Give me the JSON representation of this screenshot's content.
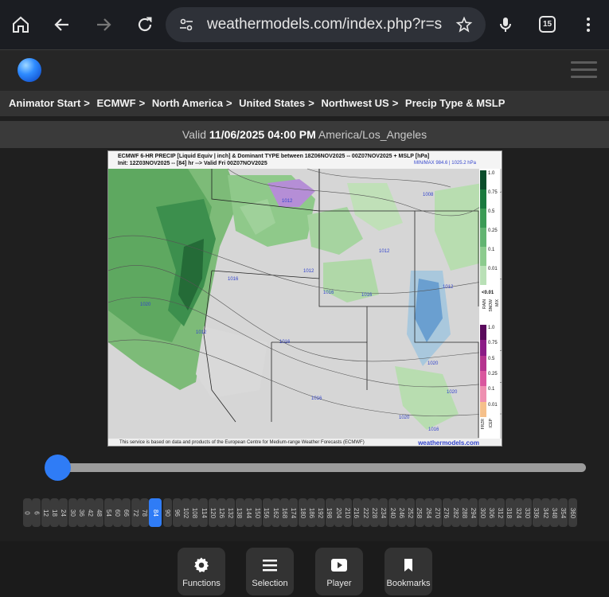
{
  "browser": {
    "url": "weathermodels.com/index.php?r=site",
    "tab_count": "15"
  },
  "breadcrumb": [
    "Animator Start",
    "ECMWF",
    "North America",
    "United States",
    "Northwest US",
    "Precip Type & MSLP"
  ],
  "valid": {
    "prefix": "Valid",
    "datetime": "11/06/2025 04:00 PM",
    "timezone": "America/Los_Angeles"
  },
  "map": {
    "title_line1": "ECMWF 6-HR PRECIP [Liquid Equiv | inch] & Dominant TYPE between 18Z06NOV2025 -- 00Z07NOV2025 + MSLP [hPa]",
    "title_line2": "Init: 12Z03NOV2025 -- [84] hr --> Valid Fri 00Z07NOV2025",
    "minmax": "MIN/MAX 984.6 | 1025.2 hPa",
    "footer": "This service is based on data and products of the European Centre for Medium-range Weather Forecasts (ECMWF)",
    "brand": "weathermodels.com",
    "rain_scale": [
      "1.0",
      "0.75",
      "0.5",
      "0.25",
      "0.1",
      "0.01"
    ],
    "rain_scale_colors": [
      "#0b4d2b",
      "#1a7a3e",
      "#3b9b55",
      "#62b471",
      "#8ccb8e",
      "#b9e0b6"
    ],
    "rain_label": "RAIN",
    "snow_label": "SNOW",
    "mix_label": "MIX",
    "lt001": "<0.01",
    "ice_scale": [
      "1.0",
      "0.75",
      "0.5",
      "0.25",
      "0.1",
      "0.01"
    ],
    "ice_scale_colors": [
      "#5a0a5c",
      "#8b1a86",
      "#b5338f",
      "#d9579e",
      "#ee8fb0",
      "#f5c08b"
    ],
    "frzr_label": "FRZR",
    "icep_label": "ICEP",
    "isobars": [
      "1012",
      "1008",
      "1016",
      "1012",
      "1012",
      "1016",
      "1012",
      "1016",
      "1020",
      "1012",
      "1016",
      "1020",
      "1016",
      "1020",
      "1020",
      "1016"
    ]
  },
  "hours": [
    "0",
    "6",
    "12",
    "18",
    "24",
    "30",
    "36",
    "42",
    "48",
    "54",
    "60",
    "66",
    "72",
    "78",
    "84",
    "90",
    "96",
    "102",
    "108",
    "114",
    "120",
    "126",
    "132",
    "138",
    "144",
    "150",
    "156",
    "162",
    "168",
    "174",
    "180",
    "186",
    "192",
    "198",
    "204",
    "210",
    "216",
    "222",
    "228",
    "234",
    "240",
    "246",
    "252",
    "258",
    "264",
    "270",
    "276",
    "282",
    "288",
    "294",
    "300",
    "306",
    "312",
    "318",
    "324",
    "330",
    "336",
    "342",
    "348",
    "354",
    "360"
  ],
  "selected_hour": "84",
  "toolbar": {
    "functions": "Functions",
    "selection": "Selection",
    "player": "Player",
    "bookmarks": "Bookmarks"
  }
}
